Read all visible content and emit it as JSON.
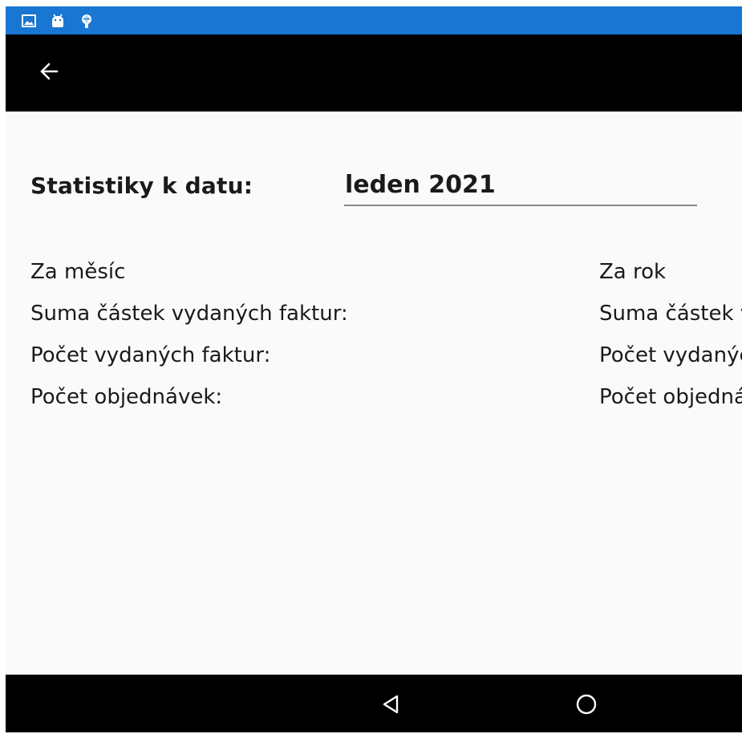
{
  "status_bar": {
    "icons": [
      "image-icon",
      "android-icon",
      "bug-icon"
    ],
    "color": "#1976d2"
  },
  "app_bar": {
    "back_icon": "arrow-back-icon",
    "color": "#000000"
  },
  "filter": {
    "label": "Statistiky k datu:",
    "value": "leden 2021"
  },
  "month_stats": {
    "heading": "Za měsíc",
    "invoice_sum_label": "Suma částek vydaných faktur:",
    "invoice_count_label": "Počet vydaných faktur:",
    "order_count_label": "Počet objednávek:"
  },
  "year_stats": {
    "heading": "Za rok",
    "invoice_sum_label": "Suma částek vydaných faktur:",
    "invoice_count_label": "Počet vydaných faktur:",
    "order_count_label": "Počet objednávek:"
  },
  "nav_bar": {
    "back_icon": "nav-back-triangle-icon",
    "home_icon": "nav-home-circle-icon"
  }
}
